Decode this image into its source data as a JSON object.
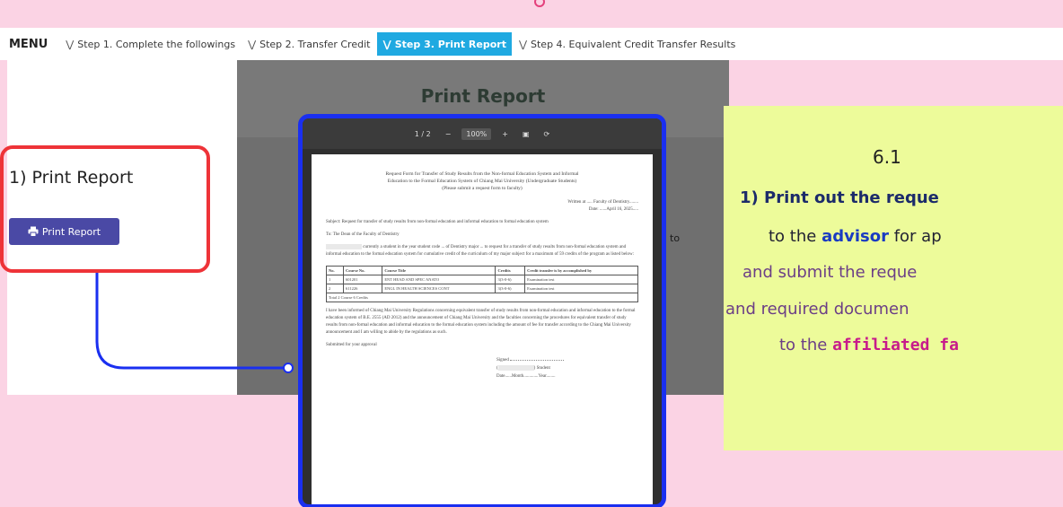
{
  "menu": {
    "label": "MENU",
    "items": [
      {
        "label": "Step 1. Complete the followings"
      },
      {
        "label": "Step 2. Transfer Credit"
      },
      {
        "label": "Step 3. Print Report"
      },
      {
        "label": "Step 4. Equivalent Credit Transfer Results"
      }
    ],
    "active_index": 2,
    "active_color": "#1fa9e1"
  },
  "page": {
    "title": "Print Report",
    "fragment": "to"
  },
  "section": {
    "heading": "1) Print Report",
    "button_label": "Print Report"
  },
  "pdf": {
    "toolbar": {
      "page": "1 / 2",
      "minus": "−",
      "zoom": "100%",
      "plus": "+"
    },
    "title_lines": [
      "Request Form for Transfer of Study Results from the Non-formal Education System and Informal",
      "Education to the Formal Education System of Chiang Mai University (Undergraduate Students)",
      "(Please submit a request form to faculty)"
    ],
    "written_at": "Written at ..... Faculty of Dentistry........",
    "date_line": "Date: ......April 16, 2025.....",
    "subject": "Subject: Request for transfer of study results from non-formal education and informal education to formal education system",
    "to": "To: The Dean of the Faculty of Dentistry",
    "body1": "currently a student in the year student code ... of Dentistry major ... to request for a transfer of study results from non-formal education system and informal education to the formal education system for cumulative credit of the curriculum of my major subject for a maximum of 59 credits of the program as listed below:",
    "table": {
      "headers": [
        "No.",
        "Course No.",
        "Course Title",
        "Credits",
        "Credit transfer is by accomplished by"
      ],
      "rows": [
        [
          "1",
          "601201",
          "ENT HEAD AND SPEC ANATO",
          "3(3-0-6)",
          "Examination test"
        ],
        [
          "2",
          "611226",
          "ENGL IN HEALTH SCIENCES CONT",
          "3(3-0-6)",
          "Examination test"
        ]
      ],
      "total": "Total 2 Course 6 Credits"
    },
    "body2": "I have been informed of Chiang Mai University Regulations concerning equivalent transfer of study results from non-formal education and informal education to the formal education system of B.E. 2555 (AD 2012) and the announcement of Chiang Mai University and the faculties concerning the procedures for equivalent transfer of study results from non-formal education and informal education to the formal education system including the amount of fee for transfer according to the Chiang Mai University announcement and I am willing to abide by the regulations as such.",
    "closing": "Submitted for your approval",
    "sign_labels": [
      "Signed",
      "Student",
      "Date......Month.............Year........"
    ]
  },
  "note": {
    "number": "6.1",
    "line1": "1) Print out the reque",
    "line2_pre": "to the ",
    "line2_bold": "advisor",
    "line2_post": " for ap",
    "line3": "and submit the reque",
    "line4": "and required documen",
    "line5_pre": "to the ",
    "line5_bold": "affiliated fa"
  },
  "colors": {
    "background": "#fbd3e4",
    "red_highlight": "#ee3338",
    "blue_highlight": "#1a2ff0",
    "button": "#4a49a5",
    "note_bg": "#edfb9a"
  }
}
